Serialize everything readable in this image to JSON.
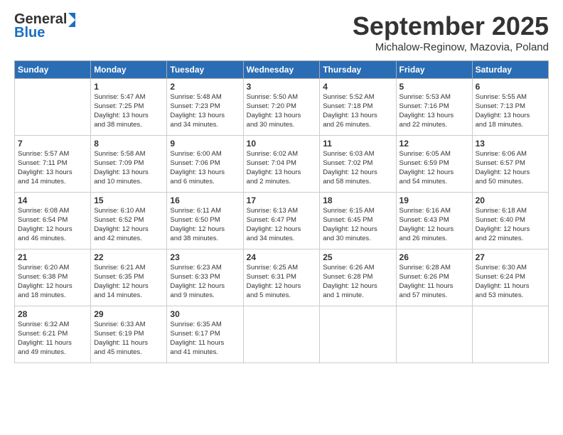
{
  "logo": {
    "line1": "General",
    "line2": "Blue"
  },
  "header": {
    "month": "September 2025",
    "location": "Michalow-Reginow, Mazovia, Poland"
  },
  "days": [
    "Sunday",
    "Monday",
    "Tuesday",
    "Wednesday",
    "Thursday",
    "Friday",
    "Saturday"
  ],
  "weeks": [
    [
      {
        "day": "",
        "content": ""
      },
      {
        "day": "1",
        "content": "Sunrise: 5:47 AM\nSunset: 7:25 PM\nDaylight: 13 hours\nand 38 minutes."
      },
      {
        "day": "2",
        "content": "Sunrise: 5:48 AM\nSunset: 7:23 PM\nDaylight: 13 hours\nand 34 minutes."
      },
      {
        "day": "3",
        "content": "Sunrise: 5:50 AM\nSunset: 7:20 PM\nDaylight: 13 hours\nand 30 minutes."
      },
      {
        "day": "4",
        "content": "Sunrise: 5:52 AM\nSunset: 7:18 PM\nDaylight: 13 hours\nand 26 minutes."
      },
      {
        "day": "5",
        "content": "Sunrise: 5:53 AM\nSunset: 7:16 PM\nDaylight: 13 hours\nand 22 minutes."
      },
      {
        "day": "6",
        "content": "Sunrise: 5:55 AM\nSunset: 7:13 PM\nDaylight: 13 hours\nand 18 minutes."
      }
    ],
    [
      {
        "day": "7",
        "content": "Sunrise: 5:57 AM\nSunset: 7:11 PM\nDaylight: 13 hours\nand 14 minutes."
      },
      {
        "day": "8",
        "content": "Sunrise: 5:58 AM\nSunset: 7:09 PM\nDaylight: 13 hours\nand 10 minutes."
      },
      {
        "day": "9",
        "content": "Sunrise: 6:00 AM\nSunset: 7:06 PM\nDaylight: 13 hours\nand 6 minutes."
      },
      {
        "day": "10",
        "content": "Sunrise: 6:02 AM\nSunset: 7:04 PM\nDaylight: 13 hours\nand 2 minutes."
      },
      {
        "day": "11",
        "content": "Sunrise: 6:03 AM\nSunset: 7:02 PM\nDaylight: 12 hours\nand 58 minutes."
      },
      {
        "day": "12",
        "content": "Sunrise: 6:05 AM\nSunset: 6:59 PM\nDaylight: 12 hours\nand 54 minutes."
      },
      {
        "day": "13",
        "content": "Sunrise: 6:06 AM\nSunset: 6:57 PM\nDaylight: 12 hours\nand 50 minutes."
      }
    ],
    [
      {
        "day": "14",
        "content": "Sunrise: 6:08 AM\nSunset: 6:54 PM\nDaylight: 12 hours\nand 46 minutes."
      },
      {
        "day": "15",
        "content": "Sunrise: 6:10 AM\nSunset: 6:52 PM\nDaylight: 12 hours\nand 42 minutes."
      },
      {
        "day": "16",
        "content": "Sunrise: 6:11 AM\nSunset: 6:50 PM\nDaylight: 12 hours\nand 38 minutes."
      },
      {
        "day": "17",
        "content": "Sunrise: 6:13 AM\nSunset: 6:47 PM\nDaylight: 12 hours\nand 34 minutes."
      },
      {
        "day": "18",
        "content": "Sunrise: 6:15 AM\nSunset: 6:45 PM\nDaylight: 12 hours\nand 30 minutes."
      },
      {
        "day": "19",
        "content": "Sunrise: 6:16 AM\nSunset: 6:43 PM\nDaylight: 12 hours\nand 26 minutes."
      },
      {
        "day": "20",
        "content": "Sunrise: 6:18 AM\nSunset: 6:40 PM\nDaylight: 12 hours\nand 22 minutes."
      }
    ],
    [
      {
        "day": "21",
        "content": "Sunrise: 6:20 AM\nSunset: 6:38 PM\nDaylight: 12 hours\nand 18 minutes."
      },
      {
        "day": "22",
        "content": "Sunrise: 6:21 AM\nSunset: 6:35 PM\nDaylight: 12 hours\nand 14 minutes."
      },
      {
        "day": "23",
        "content": "Sunrise: 6:23 AM\nSunset: 6:33 PM\nDaylight: 12 hours\nand 9 minutes."
      },
      {
        "day": "24",
        "content": "Sunrise: 6:25 AM\nSunset: 6:31 PM\nDaylight: 12 hours\nand 5 minutes."
      },
      {
        "day": "25",
        "content": "Sunrise: 6:26 AM\nSunset: 6:28 PM\nDaylight: 12 hours\nand 1 minute."
      },
      {
        "day": "26",
        "content": "Sunrise: 6:28 AM\nSunset: 6:26 PM\nDaylight: 11 hours\nand 57 minutes."
      },
      {
        "day": "27",
        "content": "Sunrise: 6:30 AM\nSunset: 6:24 PM\nDaylight: 11 hours\nand 53 minutes."
      }
    ],
    [
      {
        "day": "28",
        "content": "Sunrise: 6:32 AM\nSunset: 6:21 PM\nDaylight: 11 hours\nand 49 minutes."
      },
      {
        "day": "29",
        "content": "Sunrise: 6:33 AM\nSunset: 6:19 PM\nDaylight: 11 hours\nand 45 minutes."
      },
      {
        "day": "30",
        "content": "Sunrise: 6:35 AM\nSunset: 6:17 PM\nDaylight: 11 hours\nand 41 minutes."
      },
      {
        "day": "",
        "content": ""
      },
      {
        "day": "",
        "content": ""
      },
      {
        "day": "",
        "content": ""
      },
      {
        "day": "",
        "content": ""
      }
    ]
  ]
}
